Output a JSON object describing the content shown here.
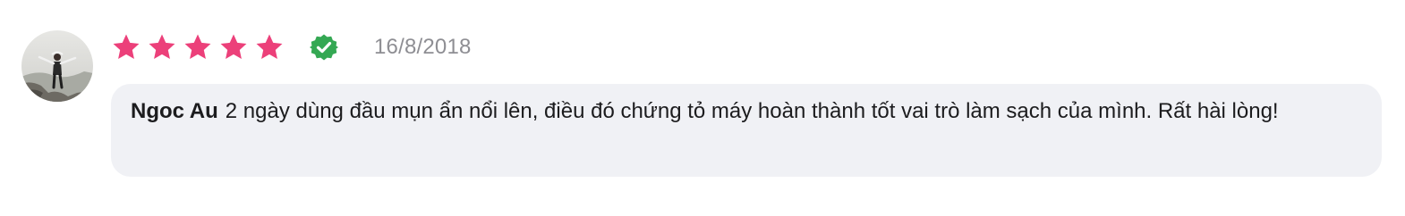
{
  "review": {
    "avatar_icon": "user-avatar-photo",
    "rating": {
      "value": 5,
      "max": 5,
      "color": "#ec407a",
      "icon": "star-icon"
    },
    "verified": {
      "icon": "verified-check-icon",
      "color": "#34a853"
    },
    "date": "16/8/2018",
    "author": "Ngoc Au",
    "text": "2 ngày dùng đầu mụn ẩn nổi lên, điều đó chứng tỏ máy hoàn thành tốt vai trò làm sạch của mình. Rất hài lòng!"
  },
  "colors": {
    "bubble_bg": "#f0f1f5",
    "date_text": "#8e8e93",
    "body_text": "#1c1c1e"
  }
}
